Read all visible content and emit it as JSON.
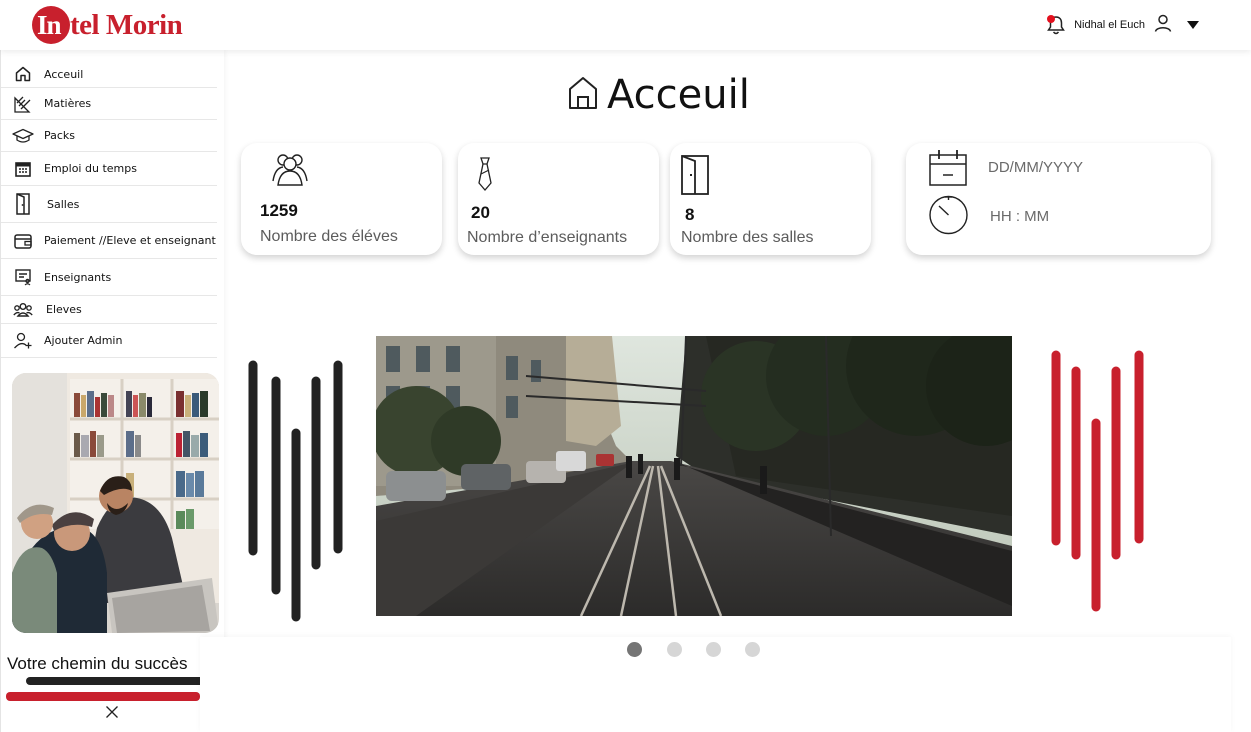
{
  "header": {
    "logo_initial": "In",
    "logo_rest": "tel Morin",
    "user_name": "Nidhal el Euch"
  },
  "sidebar": {
    "items": [
      {
        "label": "Acceuil",
        "icon": "home-icon"
      },
      {
        "label": "Matières",
        "icon": "ruler-pencil-icon"
      },
      {
        "label": "Packs",
        "icon": "graduation-cap-icon"
      },
      {
        "label": "Emploi du temps",
        "icon": "calendar-icon"
      },
      {
        "label": "Salles",
        "icon": "door-icon"
      },
      {
        "label": "Paiement //Eleve et enseignant",
        "icon": "wallet-icon"
      },
      {
        "label": "Enseignants",
        "icon": "teacher-board-icon"
      },
      {
        "label": "Eleves",
        "icon": "students-icon"
      },
      {
        "label": "Ajouter Admin",
        "icon": "add-user-icon"
      }
    ],
    "tagline": "Votre chemin du succès"
  },
  "main": {
    "title": "Acceuil",
    "stats": [
      {
        "value": "1259",
        "caption": "Nombre des éléves",
        "icon": "group-icon"
      },
      {
        "value": "20",
        "caption": "Nombre d’enseignants",
        "icon": "tie-icon"
      },
      {
        "value": "8",
        "caption": "Nombre des salles",
        "icon": "door-icon"
      }
    ],
    "date_placeholder": "DD/MM/YYYY",
    "time_placeholder": "HH : MM"
  },
  "carousel": {
    "slides": 4,
    "active_index": 0
  },
  "colors": {
    "brand_red": "#c8202d",
    "dark": "#222222"
  }
}
